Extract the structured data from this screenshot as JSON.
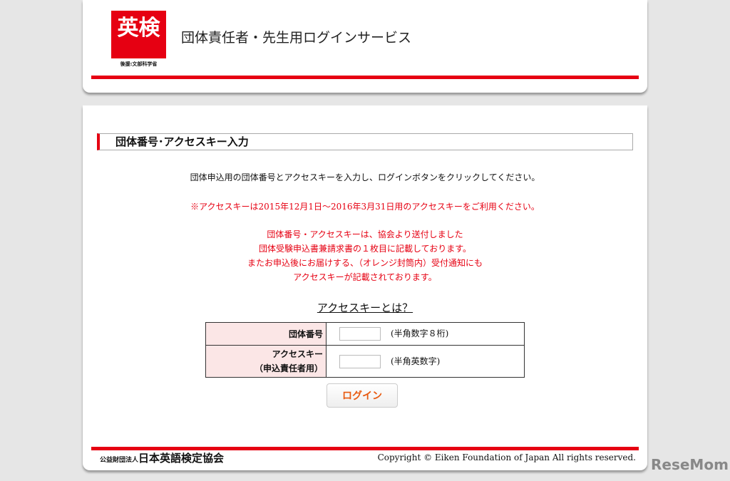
{
  "header": {
    "logo_text": "英検",
    "logo_sub": "後援:文部科学省",
    "service_title": "団体責任者・先生用ログインサービス"
  },
  "section_title": "団体番号･アクセスキー入力",
  "instruction": "団体申込用の団体番号とアクセスキーを入力し、ログインボタンをクリックしてください。",
  "notice": "※アクセスキーは2015年12月1日～2016年3月31日用のアクセスキーをご利用ください。",
  "notes": [
    "団体番号・アクセスキーは、協会より送付しました",
    "団体受験申込書兼請求書の１枚目に記載しております。",
    "またお申込後にお届けする、（オレンジ封筒内）受付通知にも",
    "アクセスキーが記載されております。"
  ],
  "what_link": "アクセスキーとは？",
  "form": {
    "group_label": "団体番号",
    "group_hint": "(半角数字８桁)",
    "group_value": "",
    "key_label": "アクセスキー",
    "key_label2": "（申込責任者用）",
    "key_hint": "(半角英数字)",
    "key_value": "",
    "login": "ログイン"
  },
  "footer": {
    "org_prefix": "公益財団法人",
    "org_name": "日本英語検定協会",
    "copyright": "Copyright © Eiken Foundation of Japan All rights reserved."
  },
  "watermark": "ReseMom"
}
